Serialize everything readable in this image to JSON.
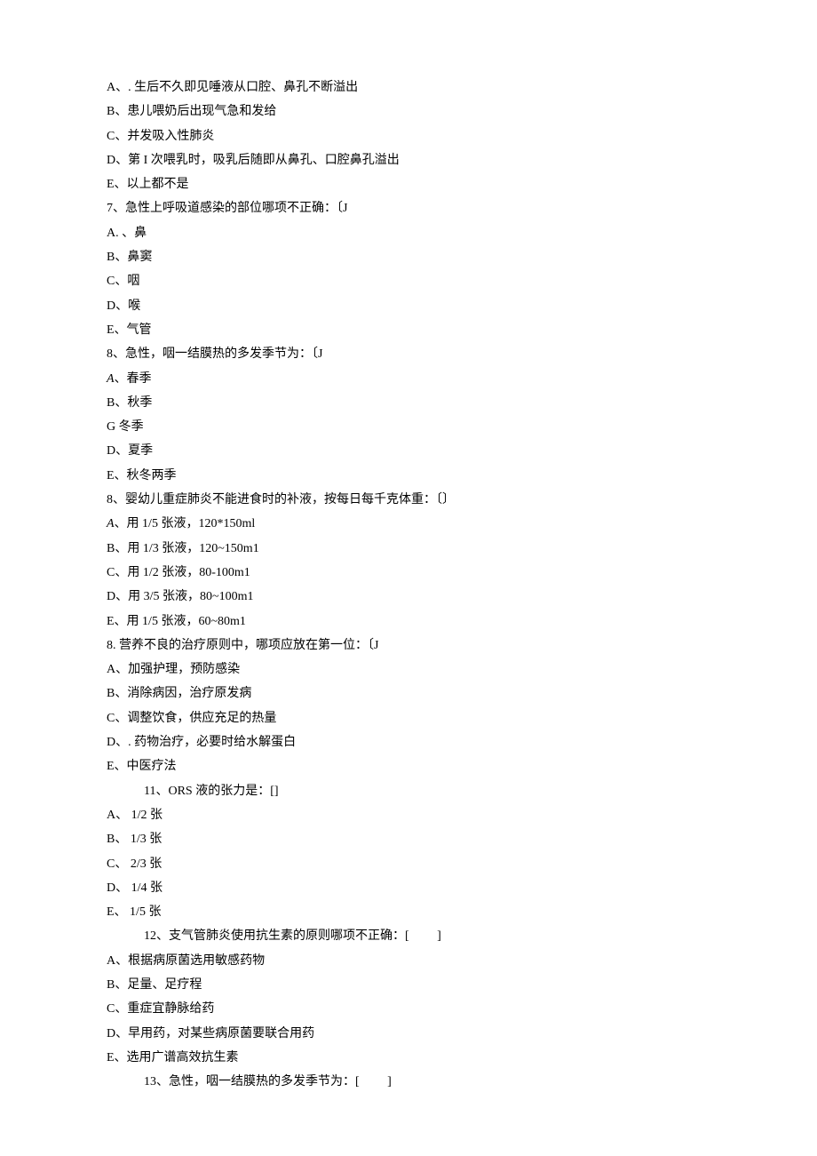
{
  "lines": [
    {
      "text": "A、. 生后不久即见唾液从口腔、鼻孔不断溢出",
      "indent": false
    },
    {
      "text": "B、患儿喂奶后出现气急和发给",
      "indent": false
    },
    {
      "text": "C、并发吸入性肺炎",
      "indent": false
    },
    {
      "text": "D、第 I 次喂乳时，吸乳后随即从鼻孔、口腔鼻孔溢出",
      "indent": false
    },
    {
      "text": "E、以上都不是",
      "indent": false
    },
    {
      "text": "7、急性上呼吸道感染的部位哪项不正确：〔J",
      "indent": false
    },
    {
      "text": "A. 、鼻",
      "indent": false
    },
    {
      "text": "B、鼻窦",
      "indent": false
    },
    {
      "text": "C、咽",
      "indent": false
    },
    {
      "text": "D、喉",
      "indent": false
    },
    {
      "text": "E、气管",
      "indent": false
    },
    {
      "text": "8、急性，咽一结膜热的多发季节为：〔J",
      "indent": false
    },
    {
      "text": "A、春季",
      "indent": false,
      "italic": true
    },
    {
      "text": "B、秋季",
      "indent": false
    },
    {
      "text": "G 冬季",
      "indent": false
    },
    {
      "text": "D、夏季",
      "indent": false
    },
    {
      "text": "E、秋冬两季",
      "indent": false
    },
    {
      "text": "8、婴幼儿重症肺炎不能进食时的补液，按每日每千克体重：〔〕",
      "indent": false
    },
    {
      "text": "A、用 1/5 张液，120*150ml",
      "indent": false,
      "italic": true
    },
    {
      "text": "B、用 1/3 张液，120~150m1",
      "indent": false
    },
    {
      "text": "C、用 1/2 张液，80-100m1",
      "indent": false
    },
    {
      "text": "D、用 3/5 张液，80~100m1",
      "indent": false
    },
    {
      "text": "E、用 1/5 张液，60~80m1",
      "indent": false
    },
    {
      "text": "8. 营养不良的治疗原则中，哪项应放在第一位：〔J",
      "indent": false
    },
    {
      "text": "A、加强护理，预防感染",
      "indent": false
    },
    {
      "text": "B、消除病因，治疗原发病",
      "indent": false
    },
    {
      "text": "C、调整饮食，供应充足的热量",
      "indent": false
    },
    {
      "text": "D、. 药物治疗，必要时给水解蛋白",
      "indent": false
    },
    {
      "text": "E、中医疗法",
      "indent": false
    },
    {
      "text": "11、ORS 液的张力是：[]",
      "indent": true
    },
    {
      "text": "A、 1/2 张",
      "indent": false
    },
    {
      "text": "B、 1/3 张",
      "indent": false
    },
    {
      "text": "C、 2/3 张",
      "indent": false
    },
    {
      "text": "D、 1/4 张",
      "indent": false
    },
    {
      "text": "E、 1/5 张",
      "indent": false
    },
    {
      "text": "12、支气管肺炎使用抗生素的原则哪项不正确：[         ]",
      "indent": true
    },
    {
      "text": "A、根据病原菌选用敏感药物",
      "indent": false
    },
    {
      "text": "B、足量、足疗程",
      "indent": false
    },
    {
      "text": "C、重症宜静脉给药",
      "indent": false
    },
    {
      "text": "D、早用药，对某些病原菌要联合用药",
      "indent": false
    },
    {
      "text": "E、选用广谱高效抗生素",
      "indent": false
    },
    {
      "text": "13、急性，咽一结膜热的多发季节为：[         ]",
      "indent": true
    }
  ]
}
